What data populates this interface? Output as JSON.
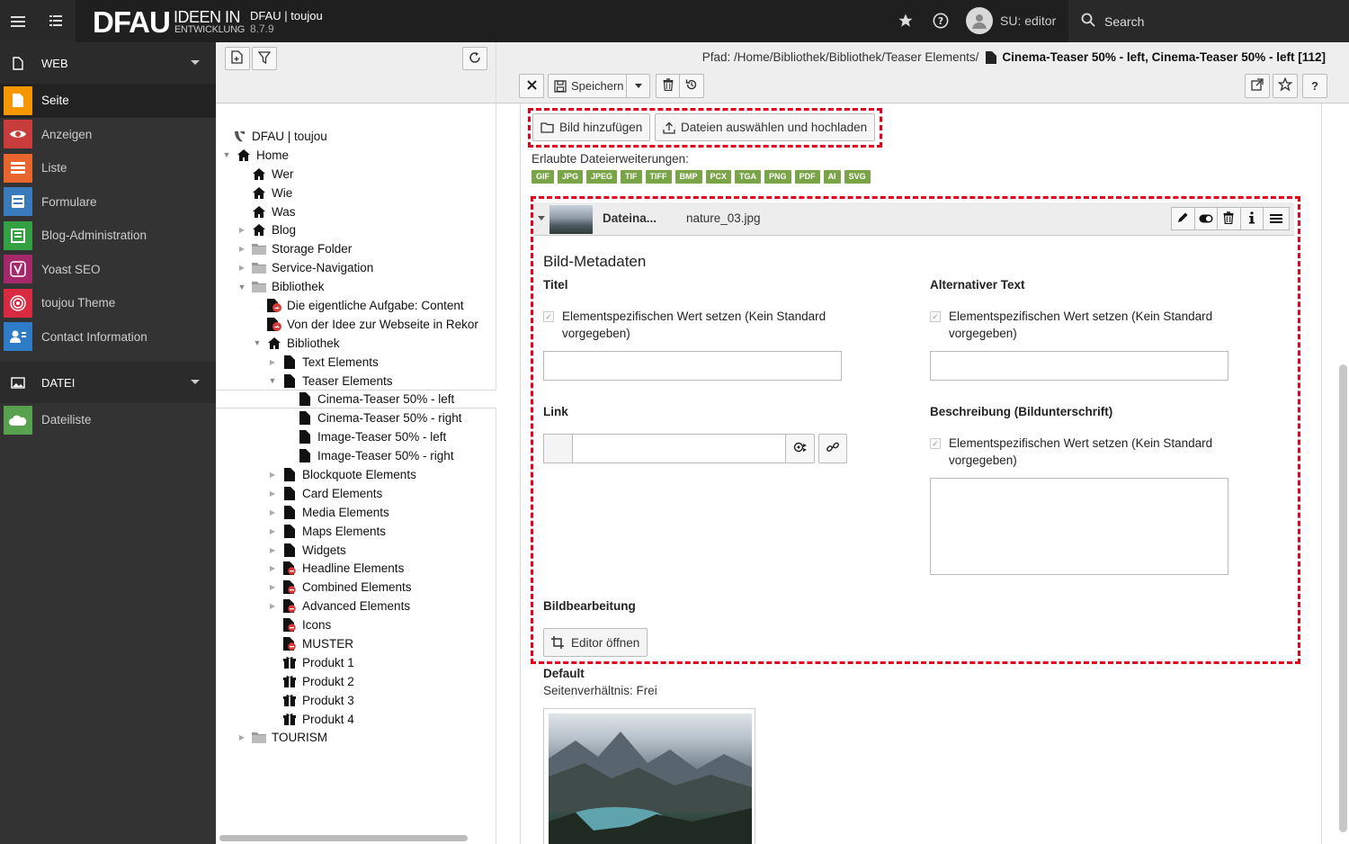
{
  "topbar": {
    "logo_main": "DFAU",
    "logo_sub1": "IDEEN IN",
    "logo_sub2": "ENTWICKLUNG",
    "site_name": "DFAU | toujou",
    "site_version": "8.7.9",
    "user_label": "SU: editor",
    "search_label": "Search"
  },
  "modules": {
    "web_group": "WEB",
    "web_items": [
      {
        "label": "Seite",
        "color": "#f49700"
      },
      {
        "label": "Anzeigen",
        "color": "#c83c3c"
      },
      {
        "label": "Liste",
        "color": "#e8662e"
      },
      {
        "label": "Formulare",
        "color": "#3a7bbd"
      },
      {
        "label": "Blog-Administration",
        "color": "#33a143"
      },
      {
        "label": "Yoast SEO",
        "color": "#a4286a"
      },
      {
        "label": "toujou Theme",
        "color": "#d82b42"
      },
      {
        "label": "Contact Information",
        "color": "#2e7cc7"
      }
    ],
    "file_group": "DATEI",
    "file_items": [
      {
        "label": "Dateiliste",
        "color": "#58a14e"
      }
    ]
  },
  "tree": {
    "root": "DFAU | toujou",
    "nodes": [
      {
        "label": "Home",
        "level": 1,
        "icon": "home",
        "toggle": "open"
      },
      {
        "label": "Wer",
        "level": 2,
        "icon": "home",
        "toggle": ""
      },
      {
        "label": "Wie",
        "level": 2,
        "icon": "home",
        "toggle": ""
      },
      {
        "label": "Was",
        "level": 2,
        "icon": "home",
        "toggle": ""
      },
      {
        "label": "Blog",
        "level": 2,
        "icon": "home",
        "toggle": "closed"
      },
      {
        "label": "Storage Folder",
        "level": 2,
        "icon": "folder",
        "toggle": "closed"
      },
      {
        "label": "Service-Navigation",
        "level": 2,
        "icon": "folder",
        "toggle": "closed"
      },
      {
        "label": "Bibliothek",
        "level": 2,
        "icon": "folder",
        "toggle": "open"
      },
      {
        "label": "Die eigentliche Aufgabe: Content",
        "level": 3,
        "icon": "shortcut",
        "toggle": ""
      },
      {
        "label": "Von der Idee zur Webseite in Rekor",
        "level": 3,
        "icon": "shortcut",
        "toggle": ""
      },
      {
        "label": "Bibliothek",
        "level": 3,
        "icon": "home",
        "toggle": "open"
      },
      {
        "label": "Text Elements",
        "level": 4,
        "icon": "page",
        "toggle": "closed"
      },
      {
        "label": "Teaser Elements",
        "level": 4,
        "icon": "page",
        "toggle": "open"
      },
      {
        "label": "Cinema-Teaser 50% - left",
        "level": 5,
        "icon": "page",
        "toggle": "",
        "selected": true
      },
      {
        "label": "Cinema-Teaser 50% - right",
        "level": 5,
        "icon": "page",
        "toggle": ""
      },
      {
        "label": "Image-Teaser 50% - left",
        "level": 5,
        "icon": "page",
        "toggle": ""
      },
      {
        "label": "Image-Teaser 50% - right",
        "level": 5,
        "icon": "page",
        "toggle": ""
      },
      {
        "label": "Blockquote Elements",
        "level": 4,
        "icon": "page",
        "toggle": "closed"
      },
      {
        "label": "Card Elements",
        "level": 4,
        "icon": "page",
        "toggle": "closed"
      },
      {
        "label": "Media Elements",
        "level": 4,
        "icon": "page",
        "toggle": "closed"
      },
      {
        "label": "Maps Elements",
        "level": 4,
        "icon": "page",
        "toggle": "closed"
      },
      {
        "label": "Widgets",
        "level": 4,
        "icon": "page",
        "toggle": "closed"
      },
      {
        "label": "Headline Elements",
        "level": 4,
        "icon": "page-hidden",
        "toggle": "closed"
      },
      {
        "label": "Combined Elements",
        "level": 4,
        "icon": "page-hidden",
        "toggle": "closed"
      },
      {
        "label": "Advanced Elements",
        "level": 4,
        "icon": "page-hidden",
        "toggle": "closed"
      },
      {
        "label": "Icons",
        "level": 4,
        "icon": "page-hidden",
        "toggle": ""
      },
      {
        "label": "MUSTER",
        "level": 4,
        "icon": "page-hidden",
        "toggle": ""
      },
      {
        "label": "Produkt 1",
        "level": 4,
        "icon": "product",
        "toggle": ""
      },
      {
        "label": "Produkt 2",
        "level": 4,
        "icon": "product",
        "toggle": ""
      },
      {
        "label": "Produkt 3",
        "level": 4,
        "icon": "product",
        "toggle": ""
      },
      {
        "label": "Produkt 4",
        "level": 4,
        "icon": "product",
        "toggle": ""
      },
      {
        "label": "TOURISM",
        "level": 2,
        "icon": "folder",
        "toggle": "closed"
      }
    ]
  },
  "docheader": {
    "path_prefix": "Pfad: /Home/Bibliothek/Bibliothek/Teaser Elements/",
    "path_title": "Cinema-Teaser 50% - left, Cinema-Teaser 50% - left [112]",
    "save_label": "Speichern",
    "help_label": "?"
  },
  "form": {
    "add_image_label": "Bild hinzufügen",
    "upload_label": "Dateien auswählen und hochladen",
    "allowed_label": "Erlaubte Dateierweiterungen:",
    "extensions": [
      "GIF",
      "JPG",
      "JPEG",
      "TIF",
      "TIFF",
      "BMP",
      "PCX",
      "TGA",
      "PNG",
      "PDF",
      "AI",
      "SVG"
    ],
    "record_title": "Dateina...",
    "record_file": "nature_03.jpg",
    "metadata_heading": "Bild-Metadaten",
    "title_label": "Titel",
    "alt_label": "Alternativer Text",
    "override_line1": "Elementspezifischen Wert setzen (Kein Standard",
    "override_line2": "vorgegeben)",
    "link_label": "Link",
    "description_label": "Beschreibung (Bildunterschrift)",
    "crop_heading": "Bildbearbeitung",
    "editor_button": "Editor öffnen",
    "variant_name": "Default",
    "aspect_ratio": "Seitenverhältnis: Frei"
  },
  "colors": {
    "topbar": "#292929",
    "module_menu": "#333333",
    "highlight_dash": "#e3001b",
    "extension_badge": "#79a548"
  }
}
